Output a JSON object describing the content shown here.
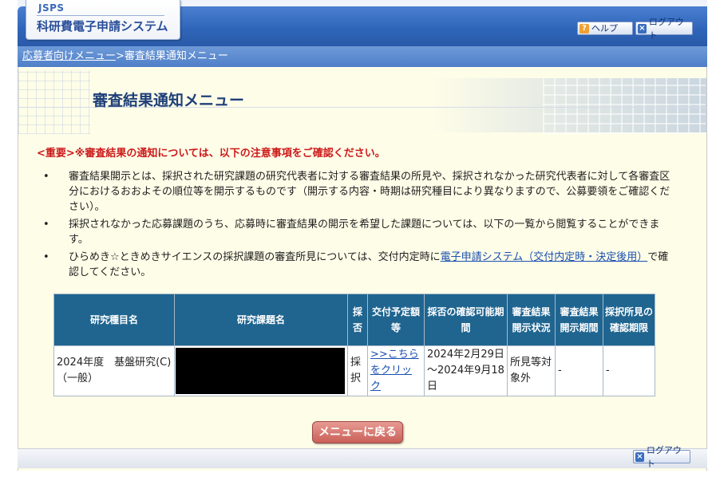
{
  "header": {
    "logo_small": "JSPS",
    "logo_main": "科研費電子申請システム",
    "help_label": "ヘルプ",
    "logout_label": "ログアウト"
  },
  "breadcrumb": {
    "parent_label": "応募者向けメニュー",
    "separator": ">",
    "current_label": "審査結果通知メニュー"
  },
  "page": {
    "title": "審査結果通知メニュー",
    "important_notice": "<重要>※審査結果の通知については、以下の注意事項をご確認ください。",
    "notes": [
      "審査結果開示とは、採択された研究課題の研究代表者に対する審査結果の所見や、採択されなかった研究代表者に対して各審査区分におけるおおよその順位等を開示するものです（開示する内容・時期は研究種目により異なりますので、公募要領をご確認ください）。",
      "採択されなかった応募課題のうち、応募時に審査結果の開示を希望した課題については、以下の一覧から閲覧することができます。"
    ],
    "note3_prefix": "ひらめき☆ときめきサイエンスの採択課題の審査所見については、交付内定時に",
    "note3_link": "電子申請システム（交付内定時・決定後用）",
    "note3_suffix": "で確認してください。"
  },
  "table": {
    "headers": {
      "type": "研究種目名",
      "project": "研究課題名",
      "adopt": "採否",
      "grant_plan": "交付予定額等",
      "confirm_period": "採否の確認可能期間",
      "disclosure_status": "審査結果開示状況",
      "disclosure_period": "審査結果開示期間",
      "opinion_period": "採択所見の確認期限"
    },
    "row": {
      "type": "2024年度　基盤研究(C)（一般）",
      "adopt": "採択",
      "grant_plan_link": ">>こちらをクリック",
      "confirm_period": "2024年2月29日～2024年9月18日",
      "disclosure_status": "所見等対象外",
      "disclosure_period": "-",
      "opinion_period": "-"
    }
  },
  "buttons": {
    "back_to_menu": "メニューに戻る",
    "footer_logout": "ログアウト"
  },
  "colors": {
    "header_blue": "#2e64b8",
    "table_header": "#1f6590",
    "important_red": "#cc1a1a",
    "back_button": "#c86058",
    "page_background": "#fefde8"
  }
}
